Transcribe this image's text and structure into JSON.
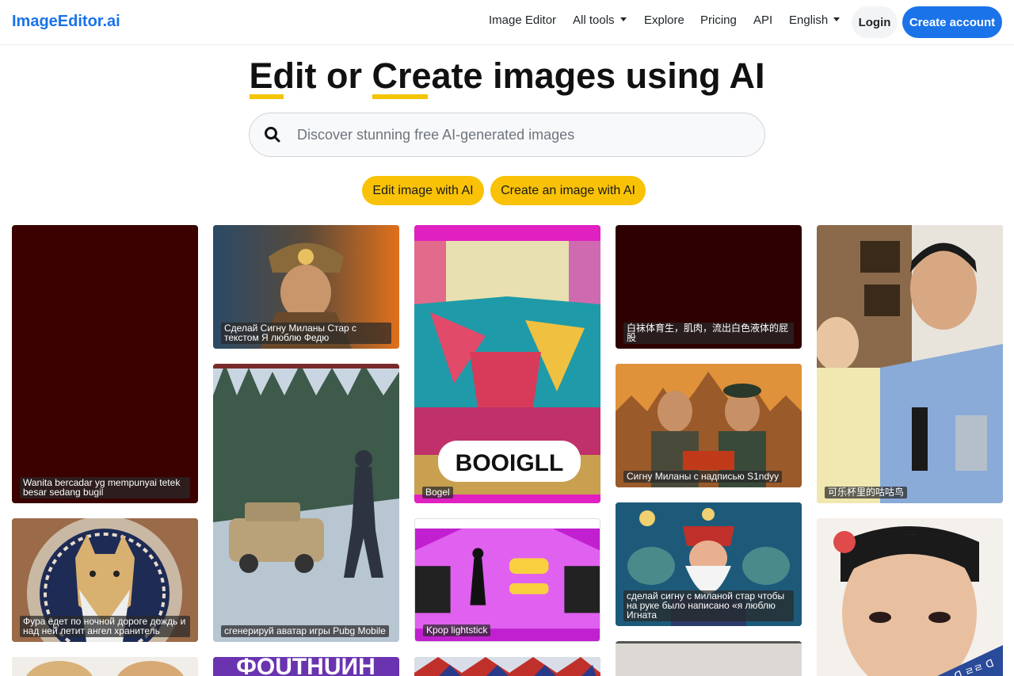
{
  "nav": {
    "brand": "ImageEditor.ai",
    "links": [
      "Image Editor",
      "All tools",
      "Explore",
      "Pricing",
      "API",
      "English"
    ],
    "login": "Login",
    "create_account": "Create account"
  },
  "hero": {
    "title_part1": "E",
    "title_part2": "dit or ",
    "title_part3": "Cre",
    "title_part4": "ate images using AI",
    "search_placeholder": "Discover stunning free AI-generated images",
    "btn_edit": "Edit image with AI",
    "btn_create": "Create an image with AI"
  },
  "gallery": [
    {
      "caption": "Wanita bercadar yg mempunyai tetek besar sedang bugil"
    },
    {
      "caption": "Фура едет по ночной дороге дождь и над ней летит ангел хранитель"
    },
    {
      "caption": ""
    },
    {
      "caption": "Сделай Сигну Миланы Стар с текстом Я люблю Федю"
    },
    {
      "caption": "сгенерируй аватар игры Pubg Mobile"
    },
    {
      "caption": ""
    },
    {
      "caption": "Bogel"
    },
    {
      "caption": "Kpop lightstick"
    },
    {
      "caption": ""
    },
    {
      "caption": "白袜体育生，肌肉，流出白色液体的屁股"
    },
    {
      "caption": "Сигну Миланы с надписью S1ndyy"
    },
    {
      "caption": "сделай сигну с миланой стар чтобы на руке было написано «я люблю Игната"
    },
    {
      "caption": ""
    },
    {
      "caption": "可乐杯里的咕咕鸟"
    },
    {
      "caption": ""
    }
  ],
  "art_text": {
    "bogel_sign": "BOOIGLL",
    "purple_banner": "ФOUTHUИH",
    "korean_tag": "ᗡ ㄹㄹ ᗡ"
  }
}
